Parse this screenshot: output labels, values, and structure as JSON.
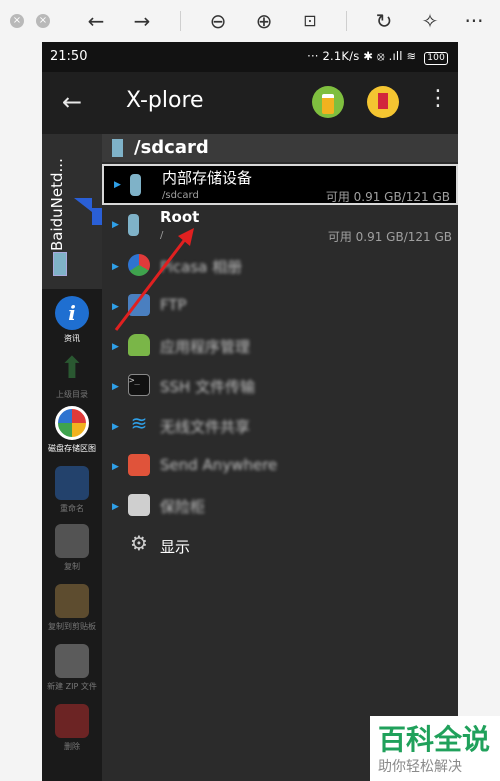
{
  "status": {
    "time": "21:50",
    "indicators": "··· 2.1K/s ✱ ⦻ .ıll ≋",
    "battery": "100"
  },
  "app": {
    "title": "X-plore",
    "back": "←",
    "menu": "⋮"
  },
  "sidebar": {
    "tab_label": "BaiduNetd...",
    "items": [
      {
        "label": "资讯",
        "icon": "info-icon"
      },
      {
        "label": "上级目录",
        "icon": "up-arrow-icon"
      },
      {
        "label": "磁盘存储区图",
        "icon": "disk-chart-icon"
      },
      {
        "label": "重命名",
        "icon": "rename-icon"
      },
      {
        "label": "复制",
        "icon": "copy-icon"
      },
      {
        "label": "复制到剪贴板",
        "icon": "clipboard-icon"
      },
      {
        "label": "新建 ZIP 文件",
        "icon": "zip-icon"
      },
      {
        "label": "删除",
        "icon": "trash-icon"
      }
    ]
  },
  "main": {
    "path": "/sdcard",
    "rows": [
      {
        "name": "内部存储设备",
        "sub": "/sdcard",
        "free": "可用 0.91 GB/121 GB",
        "icon": "sdcard-icon"
      },
      {
        "name": "Root",
        "sub": "/",
        "free": "可用 0.91 GB/121 GB",
        "icon": "sdcard-icon"
      },
      {
        "name": "Picasa 相册",
        "icon": "picasa-icon"
      },
      {
        "name": "FTP",
        "icon": "ftp-icon"
      },
      {
        "name": "应用程序管理",
        "icon": "android-icon"
      },
      {
        "name": "SSH 文件传输",
        "icon": "terminal-icon"
      },
      {
        "name": "无线文件共享",
        "icon": "wifi-icon"
      },
      {
        "name": "Send Anywhere",
        "icon": "send-icon"
      },
      {
        "name": "保险柜",
        "icon": "vault-icon"
      },
      {
        "name": "显示",
        "icon": "gears-icon"
      }
    ]
  },
  "watermark": {
    "title": "百科全说",
    "subtitle": "助你轻松解决"
  },
  "colors": {
    "accent_blue": "#2fa0e8",
    "annotation_red": "#e02020",
    "watermark_green": "#20a15b"
  }
}
